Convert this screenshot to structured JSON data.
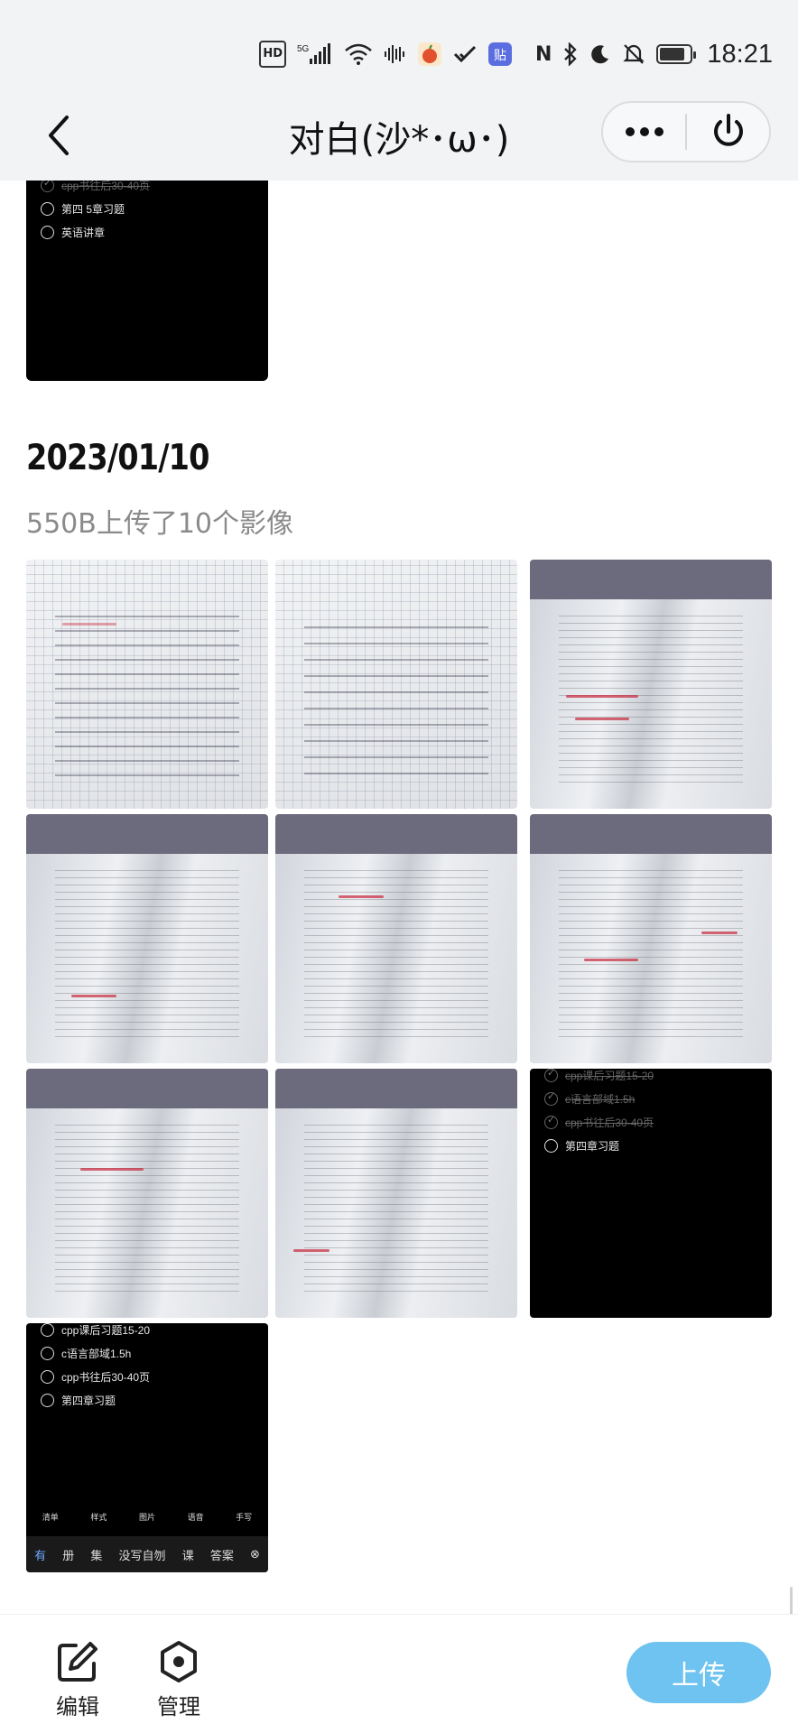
{
  "status_bar": {
    "time": "18:21",
    "hd_badge": "HD",
    "net_5g": "5G",
    "wifi_badge": "6",
    "app_badge": "贴",
    "nfc": "N",
    "battery_level": 0.85
  },
  "nav": {
    "title": "对白(沙*･ω･)",
    "more_icon": "more-dots-icon",
    "power_icon": "power-icon"
  },
  "prev_card": {
    "items": [
      {
        "label": "cpp书往后30-40页"
      },
      {
        "label": "第四 5章习题"
      },
      {
        "label": "英语讲章"
      }
    ]
  },
  "day": {
    "date": "2023/01/10",
    "summary": "550B上传了10个影像"
  },
  "photos": [
    {
      "kind": "notebook"
    },
    {
      "kind": "notebook"
    },
    {
      "kind": "book"
    },
    {
      "kind": "book"
    },
    {
      "kind": "book"
    },
    {
      "kind": "book"
    },
    {
      "kind": "book"
    },
    {
      "kind": "book"
    },
    {
      "kind": "todo-dark"
    },
    {
      "kind": "todo-dark"
    }
  ],
  "photo9_todos": [
    {
      "label": "cpp课后习题15-20",
      "done": true
    },
    {
      "label": "c语言部域1.5h",
      "done": true
    },
    {
      "label": "cpp书往后30-40页",
      "done": true
    },
    {
      "label": "第四章习题",
      "done": false
    }
  ],
  "photo10_todos": [
    {
      "label": "cpp课后习题15-20"
    },
    {
      "label": "c语言部域1.5h"
    },
    {
      "label": "cpp书往后30-40页"
    },
    {
      "label": "第四章习题"
    }
  ],
  "photo10_toolbar": [
    "清单",
    "样式",
    "图片",
    "语音",
    "手写"
  ],
  "photo10_keyboard": [
    "有",
    "册",
    "集",
    "没写自刎",
    "课",
    "答案"
  ],
  "bottom_bar": {
    "edit_label": "编辑",
    "manage_label": "管理",
    "upload_label": "上传"
  },
  "colors": {
    "accent": "#6ec3f0",
    "nav_bg": "#f2f3f5"
  }
}
